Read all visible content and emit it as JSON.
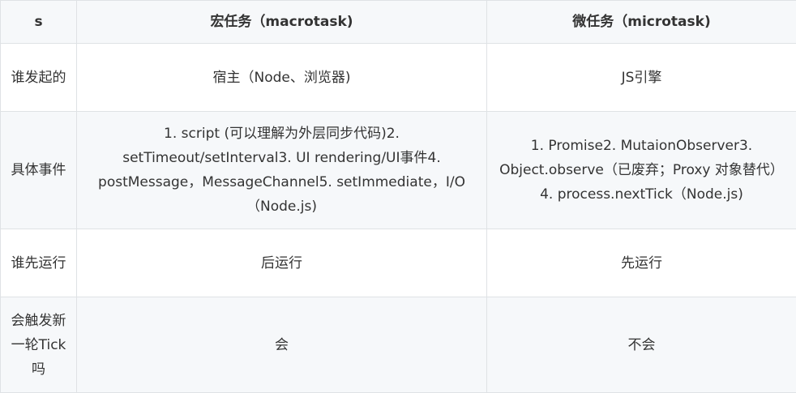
{
  "table": {
    "headers": [
      "s",
      "宏任务（macrotask)",
      "微任务（microtask)"
    ],
    "rows": [
      {
        "label": "谁发起的",
        "macro": "宿主（Node、浏览器)",
        "micro": "JS引擎"
      },
      {
        "label": "具体事件",
        "macro": "1. script (可以理解为外层同步代码)2. setTimeout/setInterval3. UI rendering/UI事件4. postMessage，MessageChannel5. setImmediate，I/O（Node.js)",
        "micro": "1. Promise2. MutaionObserver3. Object.observe（已废弃；Proxy 对象替代）4. process.nextTick（Node.js)"
      },
      {
        "label": "谁先运行",
        "macro": "后运行",
        "micro": "先运行"
      },
      {
        "label": "会触发新一轮Tick吗",
        "macro": "会",
        "micro": "不会"
      }
    ]
  },
  "colors": {
    "border": "#dfe2e5",
    "header_bg": "#f6f8fa",
    "alt_row_bg": "#f6f8fa",
    "text": "#333333"
  }
}
